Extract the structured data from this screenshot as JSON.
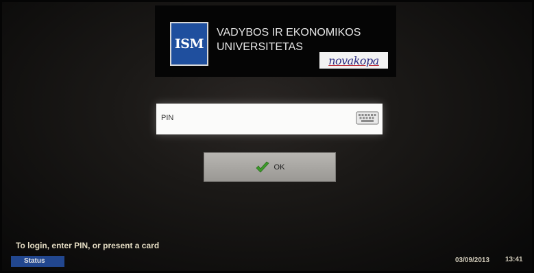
{
  "branding": {
    "ism_logo_text": "ISM",
    "university_line1": "VADYBOS IR EKONOMIKOS",
    "university_line2": "UNIVERSITETAS",
    "partner_logo_text": "novakopa"
  },
  "login": {
    "pin_placeholder": "PIN",
    "keyboard_icon": "keyboard-icon",
    "ok_label": "OK",
    "ok_icon": "checkmark-icon"
  },
  "footer": {
    "hint": "To login, enter PIN, or present a card",
    "status_label": "Status",
    "date": "03/09/2013",
    "time": "13:41"
  },
  "colors": {
    "ism_blue": "#1f4f9e",
    "status_blue": "#22478f",
    "check_green": "#3c9a2a"
  }
}
